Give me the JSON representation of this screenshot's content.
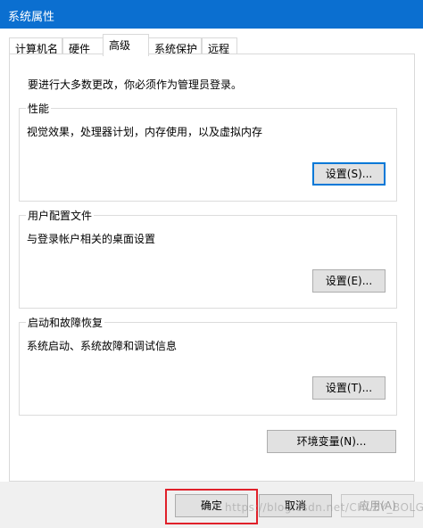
{
  "window": {
    "title": "系统属性"
  },
  "tabs": [
    "计算机名",
    "硬件",
    "高级",
    "系统保护",
    "远程"
  ],
  "active_tab_index": 2,
  "admin_note": "要进行大多数更改，你必须作为管理员登录。",
  "performance": {
    "legend": "性能",
    "description": "视觉效果，处理器计划，内存使用，以及虚拟内存",
    "button": "设置(S)..."
  },
  "user_profiles": {
    "legend": "用户配置文件",
    "description": "与登录帐户相关的桌面设置",
    "button": "设置(E)..."
  },
  "startup_recovery": {
    "legend": "启动和故障恢复",
    "description": "系统启动、系统故障和调试信息",
    "button": "设置(T)..."
  },
  "env_button": "环境变量(N)...",
  "footer": {
    "ok": "确定",
    "cancel": "取消",
    "apply": "应用(A)"
  },
  "watermark": "https://blog.csdn.net/CHLZY_BOLG",
  "colors": {
    "titlebar": "#0b6fd0",
    "focus": "#0078d7",
    "highlight_box": "#e0202a"
  }
}
